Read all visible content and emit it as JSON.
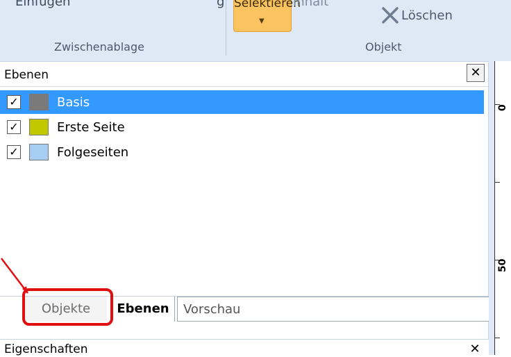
{
  "ribbon": {
    "paste_label": "Einfügen",
    "partial_label": "g",
    "select_label": "Selektieren",
    "content_label": "Inhalt",
    "delete_label": "Löschen",
    "group_clipboard": "Zwischenablage",
    "group_object": "Objekt",
    "select_color": "#fcc461"
  },
  "layers_panel": {
    "title": "Ebenen",
    "close_glyph": "✕",
    "items": [
      {
        "label": "Basis",
        "checked": true,
        "selected": true,
        "color": "#7a7a7a"
      },
      {
        "label": "Erste Seite",
        "checked": true,
        "selected": false,
        "color": "#c2c800"
      },
      {
        "label": "Folgeseiten",
        "checked": true,
        "selected": false,
        "color": "#a8cdf2"
      }
    ],
    "tabs": [
      {
        "label": "Objekte",
        "active": false
      },
      {
        "label": "Ebenen",
        "active": true
      },
      {
        "label": "Vorschau",
        "active": false
      }
    ]
  },
  "properties_panel": {
    "title": "Eigenschaften",
    "close_glyph": "✕"
  },
  "ruler": {
    "labels": [
      "0",
      "50"
    ]
  },
  "colors": {
    "selection": "#3399ff",
    "highlight": "#e01010",
    "ribbon_bg": "#dfe9f5"
  }
}
